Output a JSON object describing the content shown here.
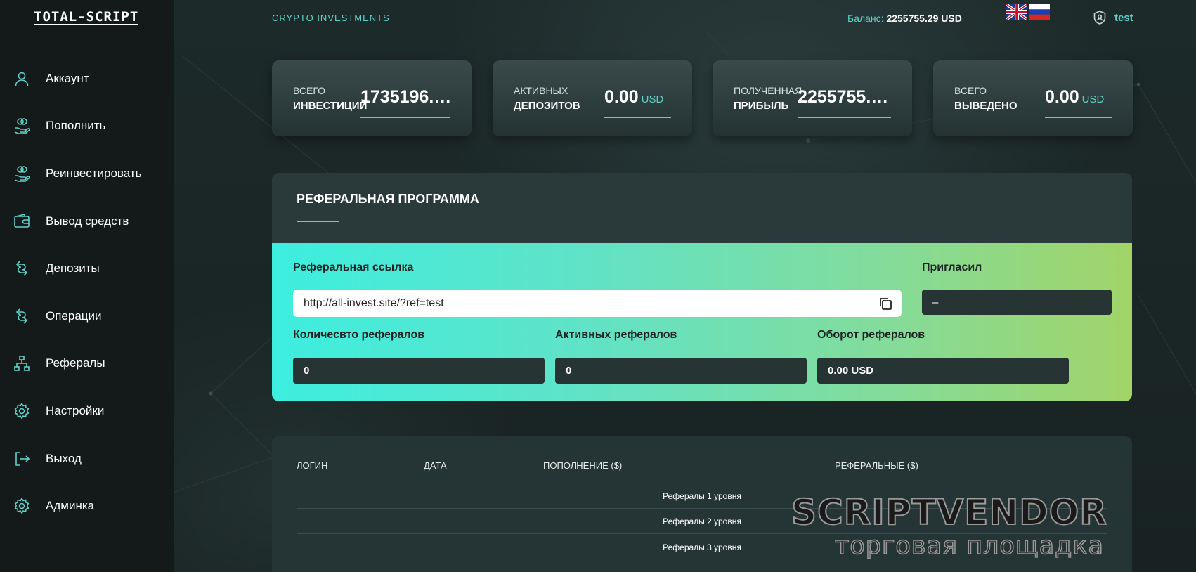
{
  "header": {
    "logo": "TOTAL-SCRIPT",
    "tagline": "CRYPTO INVESTMENTS",
    "balance_label": "Баланс:",
    "balance_value": "2255755.29 USD",
    "languages": [
      "english-flag",
      "russian-flag"
    ],
    "username": "test"
  },
  "sidebar": {
    "items": [
      {
        "label": "Аккаунт",
        "icon": "user-icon"
      },
      {
        "label": "Пополнить",
        "icon": "coins-hand-icon"
      },
      {
        "label": "Реинвестировать",
        "icon": "coins-hand-icon"
      },
      {
        "label": "Вывод средств",
        "icon": "wallet-icon"
      },
      {
        "label": "Депозиты",
        "icon": "transfer-icon"
      },
      {
        "label": "Операции",
        "icon": "transfer-icon"
      },
      {
        "label": "Рефералы",
        "icon": "hierarchy-icon"
      },
      {
        "label": "Настройки",
        "icon": "gear-icon"
      },
      {
        "label": "Выход",
        "icon": "logout-icon"
      },
      {
        "label": "Админка",
        "icon": "gear-icon"
      }
    ]
  },
  "stats": [
    {
      "label1": "ВСЕГО",
      "label2": "ИНВЕСТИЦИЙ",
      "value": "1735196.…",
      "unit": ""
    },
    {
      "label1": "АКТИВНЫХ",
      "label2": "ДЕПОЗИТОВ",
      "value": "0.00",
      "unit": "USD"
    },
    {
      "label1": "ПОЛУЧЕННАЯ",
      "label2": "ПРИБЫЛЬ",
      "value": "2255755.…",
      "unit": ""
    },
    {
      "label1": "ВСЕГО",
      "label2": "ВЫВЕДЕНО",
      "value": "0.00",
      "unit": "USD"
    }
  ],
  "referral": {
    "title": "РЕФЕРАЛЬНАЯ ПРОГРАММА",
    "link_label": "Реферальная ссылка",
    "link_value": "http://all-invest.site/?ref=test",
    "invited_label": "Пригласил",
    "invited_value": "–",
    "count_label": "Количесвто рефералов",
    "count_value": "0",
    "active_label": "Активных рефералов",
    "active_value": "0",
    "turnover_label": "Оборот рефералов",
    "turnover_value": "0.00 USD"
  },
  "table": {
    "columns": [
      "ЛОГИН",
      "ДАТА",
      "ПОПОЛНЕНИЕ ($)",
      "РЕФЕРАЛЬНЫЕ ($)"
    ],
    "rows": [
      "Рефералы 1 уровня",
      "Рефералы 2 уровня",
      "Рефералы 3 уровня"
    ]
  },
  "watermark": {
    "logo": "SCRIPTVENDOR",
    "subtitle": "торговая площадка"
  },
  "colors": {
    "accent": "#5fd1c8",
    "sidebar_bg": "#141a1a",
    "gradient_start": "#3deedf",
    "gradient_end": "#a2d468"
  }
}
